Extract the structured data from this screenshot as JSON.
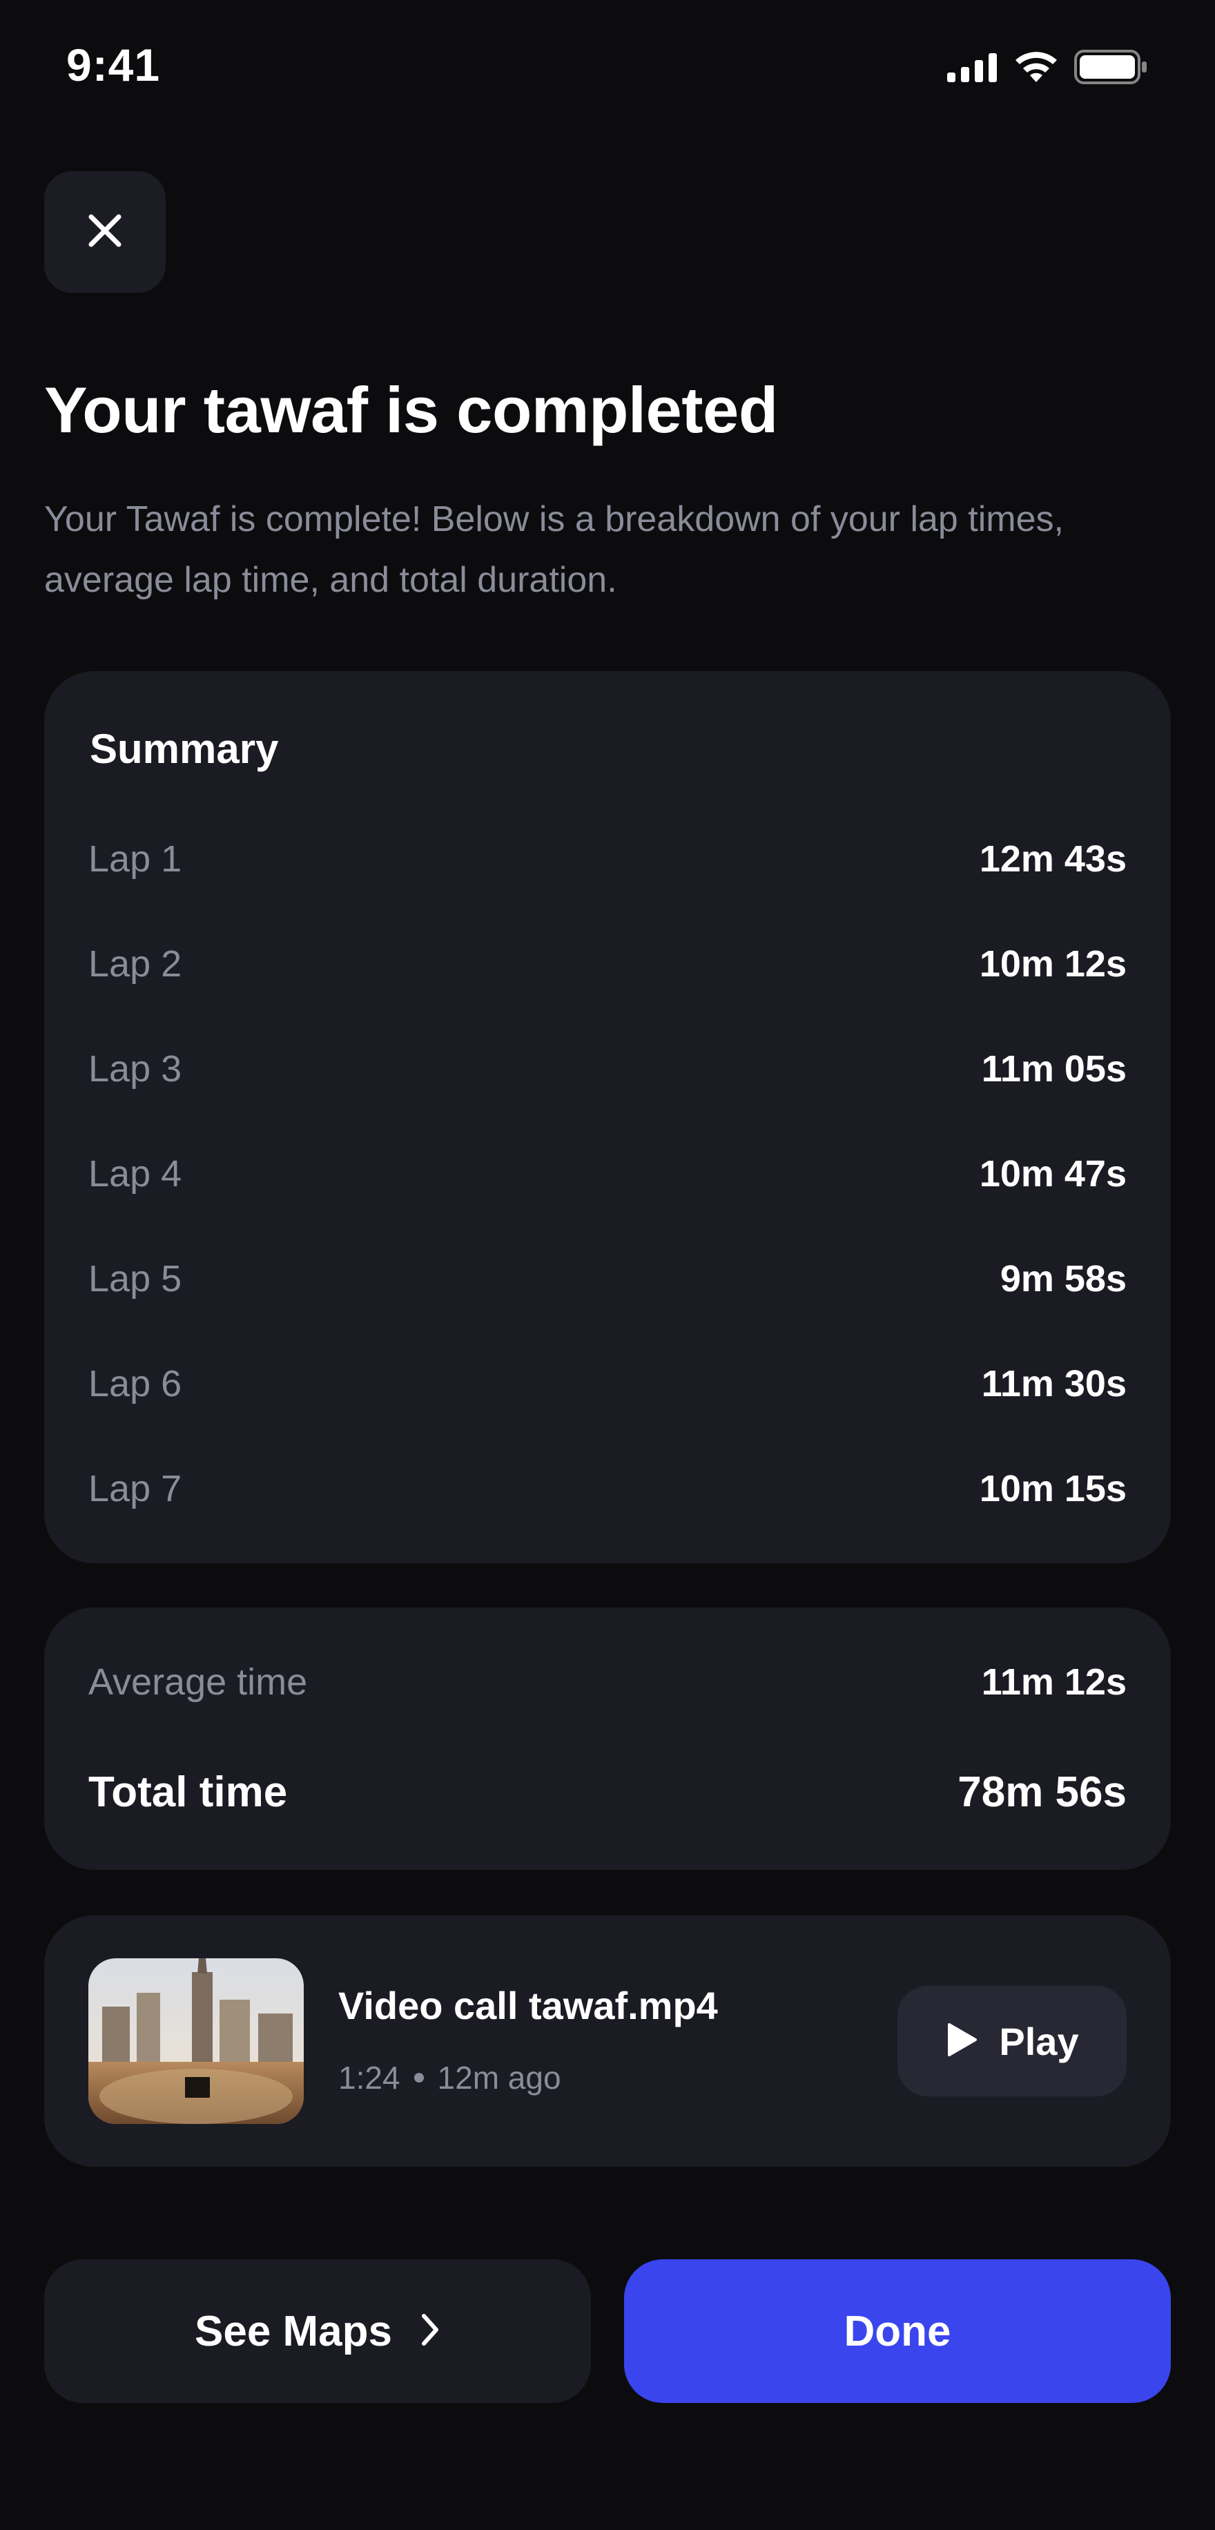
{
  "status_bar": {
    "time": "9:41",
    "icons": [
      "signal-icon",
      "wifi-icon",
      "battery-icon"
    ]
  },
  "header": {
    "close_icon": "close-icon",
    "title": "Your tawaf is completed",
    "subtitle": "Your Tawaf is complete! Below is a breakdown of your lap times, average lap time, and total duration."
  },
  "summary": {
    "title": "Summary",
    "laps": [
      {
        "label": "Lap 1",
        "value": "12m 43s"
      },
      {
        "label": "Lap 2",
        "value": "10m 12s"
      },
      {
        "label": "Lap 3",
        "value": "11m 05s"
      },
      {
        "label": "Lap 4",
        "value": "10m 47s"
      },
      {
        "label": "Lap 5",
        "value": "9m 58s"
      },
      {
        "label": "Lap 6",
        "value": "11m 30s"
      },
      {
        "label": "Lap 7",
        "value": "10m 15s"
      }
    ]
  },
  "totals": {
    "average_label": "Average time",
    "average_value": "11m 12s",
    "total_label": "Total time",
    "total_value": "78m 56s"
  },
  "video": {
    "name": "Video call tawaf.mp4",
    "duration": "1:24",
    "age": "12m ago",
    "play_label": "Play",
    "play_icon": "play-icon"
  },
  "actions": {
    "maps_label": "See Maps",
    "maps_icon": "chevron-right-icon",
    "done_label": "Done"
  },
  "colors": {
    "background": "#0c0c0f",
    "card": "#1b1b23",
    "accent": "#3a45ee",
    "muted_text": "#8a8c99"
  }
}
